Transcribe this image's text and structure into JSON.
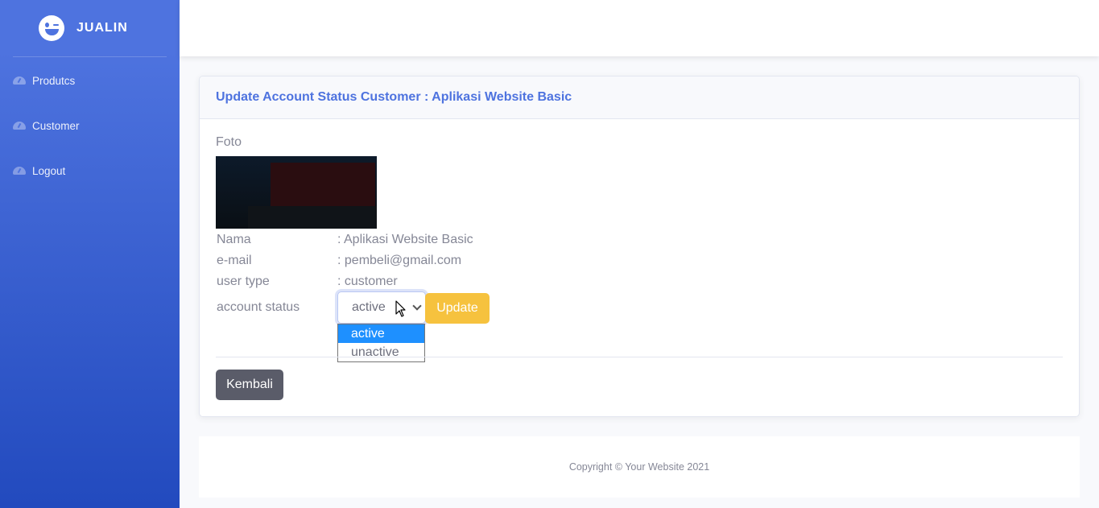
{
  "brand": {
    "name": "JUALIN",
    "logo_icon": "laugh-wink-icon"
  },
  "sidebar": {
    "items": [
      {
        "label": "Produtcs",
        "icon": "tachometer-icon"
      },
      {
        "label": "Customer",
        "icon": "tachometer-icon"
      },
      {
        "label": "Logout",
        "icon": "tachometer-icon"
      }
    ]
  },
  "card": {
    "title": "Update Account Status Customer : Aplikasi Website Basic",
    "foto_label": "Foto",
    "fields": {
      "nama_label": "Nama",
      "nama_value": ": Aplikasi Website Basic",
      "email_label": "e-mail",
      "email_value": ": pembeli@gmail.com",
      "type_label": "user type",
      "type_value": ": customer",
      "status_label": "account status"
    },
    "status_select": {
      "selected": "active",
      "options": [
        "active",
        "unactive"
      ]
    },
    "update_button": "Update",
    "back_button": "Kembali"
  },
  "footer": {
    "copyright": "Copyright © Your Website 2021"
  },
  "colors": {
    "primary": "#4e73df",
    "warning": "#f6c23e",
    "secondary": "#5a5c69",
    "dropdown_highlight": "#1e90ff"
  }
}
